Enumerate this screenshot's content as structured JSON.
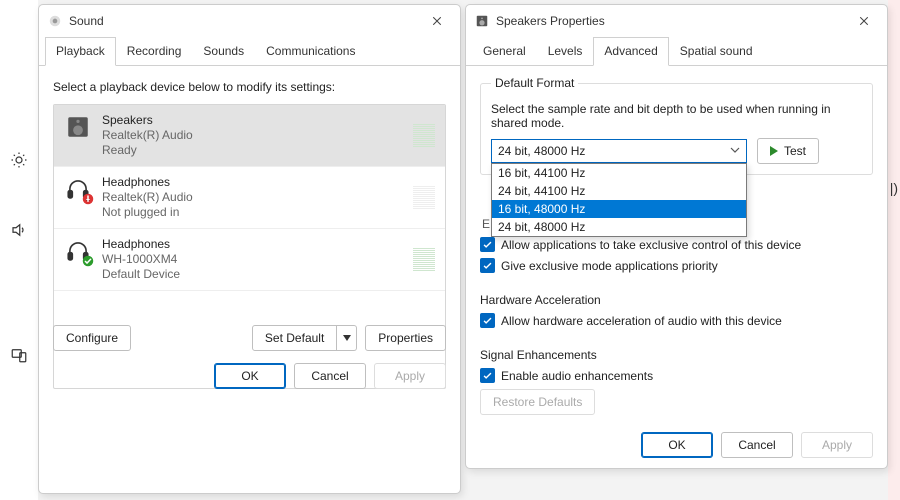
{
  "sidebar": {
    "icons": [
      "brightness",
      "volume",
      "devices"
    ]
  },
  "right_peek_text": "|)",
  "sound": {
    "title": "Sound",
    "tabs": [
      {
        "label": "Playback",
        "active": true
      },
      {
        "label": "Recording",
        "active": false
      },
      {
        "label": "Sounds",
        "active": false
      },
      {
        "label": "Communications",
        "active": false
      }
    ],
    "instruction": "Select a playback device below to modify its settings:",
    "devices": [
      {
        "name": "Speakers",
        "sub": "Realtek(R) Audio",
        "state": "Ready",
        "selected": true,
        "icon": "speaker",
        "badge": null
      },
      {
        "name": "Headphones",
        "sub": "Realtek(R) Audio",
        "state": "Not plugged in",
        "selected": false,
        "icon": "headphones",
        "badge": "unplugged"
      },
      {
        "name": "Headphones",
        "sub": "WH-1000XM4",
        "state": "Default Device",
        "selected": false,
        "icon": "headphones",
        "badge": "default"
      }
    ],
    "buttons": {
      "configure": "Configure",
      "set_default": "Set Default",
      "properties": "Properties",
      "ok": "OK",
      "cancel": "Cancel",
      "apply": "Apply"
    }
  },
  "props": {
    "title": "Speakers Properties",
    "tabs": [
      {
        "label": "General",
        "active": false
      },
      {
        "label": "Levels",
        "active": false
      },
      {
        "label": "Advanced",
        "active": true
      },
      {
        "label": "Spatial sound",
        "active": false
      }
    ],
    "default_format": {
      "group": "Default Format",
      "desc": "Select the sample rate and bit depth to be used when running in shared mode.",
      "selected": "24 bit, 48000 Hz",
      "options": [
        {
          "label": "16 bit, 44100 Hz",
          "hilite": false
        },
        {
          "label": "24 bit, 44100 Hz",
          "hilite": false
        },
        {
          "label": "16 bit, 48000 Hz",
          "hilite": true
        },
        {
          "label": "24 bit, 48000 Hz",
          "hilite": false
        }
      ],
      "test": "Test"
    },
    "exclusive": {
      "group_initial": "E",
      "cb1": "Allow applications to take exclusive control of this device",
      "cb2": "Give exclusive mode applications priority"
    },
    "hwaccel": {
      "group": "Hardware Acceleration",
      "cb": "Allow hardware acceleration of audio with this device"
    },
    "enh": {
      "group": "Signal Enhancements",
      "cb": "Enable audio enhancements"
    },
    "restore": "Restore Defaults",
    "buttons": {
      "ok": "OK",
      "cancel": "Cancel",
      "apply": "Apply"
    }
  }
}
